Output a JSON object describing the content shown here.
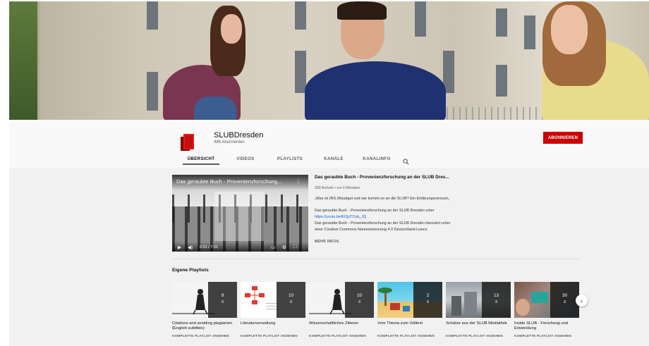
{
  "channel": {
    "name": "SLUBDresden",
    "subscribers": "486 Abonnenten",
    "subscribe_label": "ABONNIEREN",
    "brand_color": "#cc0000"
  },
  "tabs": [
    {
      "label": "ÜBERSICHT",
      "active": true
    },
    {
      "label": "VIDEOS",
      "active": false
    },
    {
      "label": "PLAYLISTS",
      "active": false
    },
    {
      "label": "KANÄLE",
      "active": false
    },
    {
      "label": "KANALINFO",
      "active": false
    }
  ],
  "featured": {
    "player_title": "Das geraubte Buch - Provenienzforschung...",
    "time": "0:01 / 7:31",
    "title": "Das geraubte Buch - Provenienzforschung an der SLUB Dres...",
    "meta": "283 Aufrufe • vor 4 Monaten",
    "desc_1": "„Was ist (NS-)Raubgut und wie kommt es an die SLUB? Ein Erklärungsversuch„",
    "desc_2_text": "Das geraubte Buch - Provenienzforschung an der SLUB Dresden unter ",
    "desc_2_link": "https://youtu.be/EOjzTCob_JQ",
    "desc_3": "Das geraubte Buch - Provenienzforschung an der SLUB Dresden lizenziert unter einer Creative Commons Namensnennung 4.0 Deutschland Lizenz",
    "more": "MEHR INFOS"
  },
  "playlists_heading": "Eigene Playlists",
  "playlists": [
    {
      "title": "Citations and avoiding plagiarism (English subtitles)",
      "count": "9",
      "link": "KOMPLETTE PLAYLIST ANSEHEN"
    },
    {
      "title": "Literaturverwaltung",
      "count": "10",
      "link": "KOMPLETTE PLAYLIST ANSEHEN"
    },
    {
      "title": "Wissenschaftliches Zitieren",
      "count": "10",
      "link": "KOMPLETTE PLAYLIST ANSEHEN"
    },
    {
      "title": "Vom Thema zum Volltext",
      "count": "2",
      "link": "KOMPLETTE PLAYLIST ANSEHEN"
    },
    {
      "title": "Schätze aus der SLUB Mediathek",
      "count": "13",
      "link": "KOMPLETTE PLAYLIST ANSEHEN"
    },
    {
      "title": "Inside SLUB - Forschung und Entwicklung",
      "count": "30",
      "link": "KOMPLETTE PLAYLIST ANSEHEN"
    }
  ],
  "icons": {
    "search": "search-icon",
    "play": "play-icon",
    "volume": "volume-icon",
    "next": "chevron-right-icon"
  }
}
